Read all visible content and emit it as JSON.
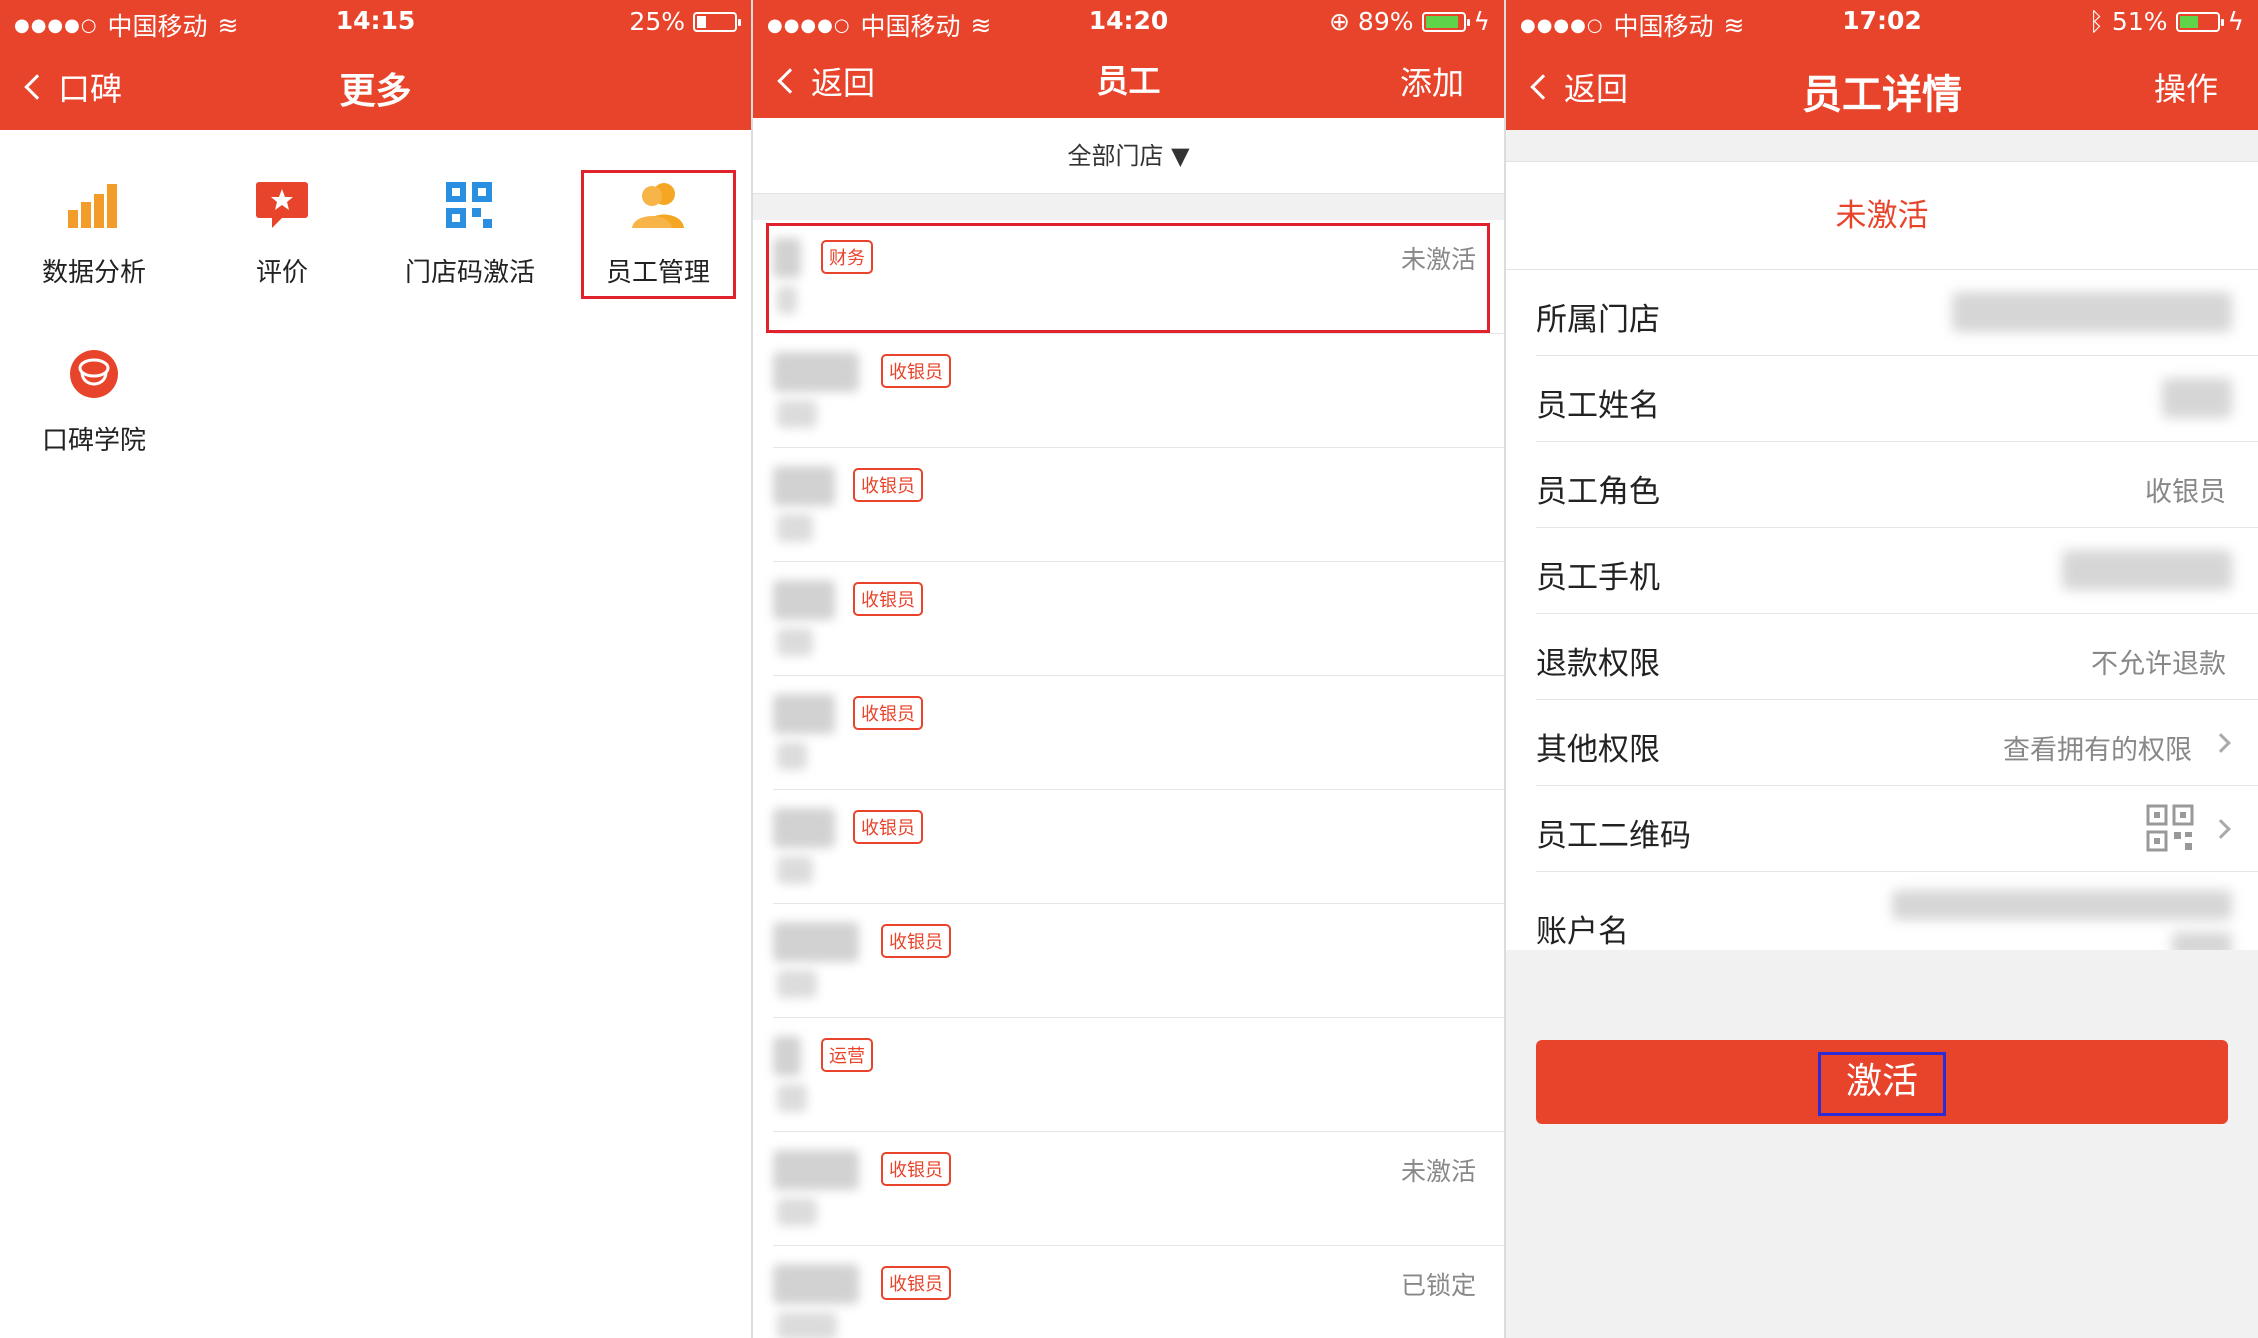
{
  "panel1": {
    "status": {
      "carrier": "中国移动",
      "time": "14:15",
      "battery": "25%",
      "battery_level": 0.25
    },
    "nav": {
      "back": "口碑",
      "title": "更多"
    },
    "tiles": [
      {
        "label": "数据分析",
        "icon": "bar-chart-icon"
      },
      {
        "label": "评价",
        "icon": "star-comment-icon"
      },
      {
        "label": "门店码激活",
        "icon": "qr-grid-icon"
      },
      {
        "label": "员工管理",
        "icon": "people-icon"
      },
      {
        "label": "口碑学院",
        "icon": "academy-icon"
      }
    ]
  },
  "panel2": {
    "status": {
      "carrier": "中国移动",
      "time": "14:20",
      "battery": "89%",
      "battery_level": 0.89
    },
    "nav": {
      "back": "返回",
      "title": "员工",
      "action": "添加"
    },
    "filter": "全部门店 ▼",
    "employees": [
      {
        "role": "财务",
        "status": "未激活"
      },
      {
        "role": "收银员",
        "status": ""
      },
      {
        "role": "收银员",
        "status": ""
      },
      {
        "role": "收银员",
        "status": ""
      },
      {
        "role": "收银员",
        "status": ""
      },
      {
        "role": "收银员",
        "status": ""
      },
      {
        "role": "收银员",
        "status": ""
      },
      {
        "role": "运营",
        "status": ""
      },
      {
        "role": "收银员",
        "status": "未激活"
      },
      {
        "role": "收银员",
        "status": "已锁定"
      }
    ]
  },
  "panel3": {
    "status": {
      "carrier": "中国移动",
      "time": "17:02",
      "battery": "51%",
      "battery_level": 0.51
    },
    "nav": {
      "back": "返回",
      "title": "员工详情",
      "action": "操作"
    },
    "banner": "未激活",
    "rows": [
      {
        "key": "所属门店",
        "value": ""
      },
      {
        "key": "员工姓名",
        "value": ""
      },
      {
        "key": "员工角色",
        "value": "收银员"
      },
      {
        "key": "员工手机",
        "value": ""
      },
      {
        "key": "退款权限",
        "value": "不允许退款"
      },
      {
        "key": "其他权限",
        "value": "查看拥有的权限"
      },
      {
        "key": "员工二维码",
        "value": ""
      },
      {
        "key": "账户名",
        "value": ""
      }
    ],
    "activate_label": "激活"
  }
}
